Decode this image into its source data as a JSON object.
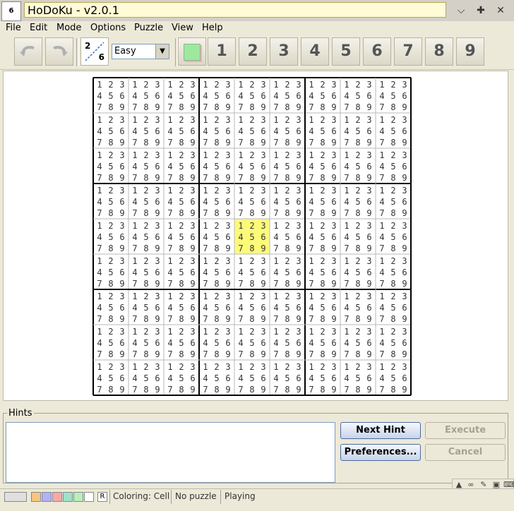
{
  "window": {
    "title": "HoDoKu - v2.0.1",
    "app_icon_text": "6",
    "controls": [
      "chevron-down-icon",
      "maximize-icon",
      "close-icon"
    ]
  },
  "menu": [
    {
      "label": "File"
    },
    {
      "label": "Edit"
    },
    {
      "label": "Mode"
    },
    {
      "label": "Options"
    },
    {
      "label": "Puzzle"
    },
    {
      "label": "View"
    },
    {
      "label": "Help"
    }
  ],
  "toolbar": {
    "undo_icon": "undo-icon",
    "redo_icon": "redo-icon",
    "candidates_icon_text_top": "2",
    "candidates_icon_text_bottom": "6",
    "level": "Easy",
    "digits": [
      "1",
      "2",
      "3",
      "4",
      "5",
      "6",
      "7",
      "8",
      "9"
    ],
    "filter_color": "#9ee89e"
  },
  "board": {
    "candidates": [
      "1",
      "2",
      "3",
      "4",
      "5",
      "6",
      "7",
      "8",
      "9"
    ],
    "highlight_cell": {
      "row": 5,
      "col": 5
    },
    "highlight_color": "#fdfa7a"
  },
  "hints": {
    "label": "Hints",
    "text": "",
    "next_hint": "Next Hint",
    "execute": "Execute",
    "preferences": "Preferences...",
    "cancel": "Cancel"
  },
  "status": {
    "swatches": [
      "#e0e0e0",
      "#f7c680",
      "#b2b2f5",
      "#f5aaaa",
      "#9ce3c8",
      "#b8f0b8",
      "#ffffff"
    ],
    "reset_label": "R",
    "coloring": "Coloring: Cell",
    "puzzle": "No puzzle",
    "mode": "Playing"
  }
}
